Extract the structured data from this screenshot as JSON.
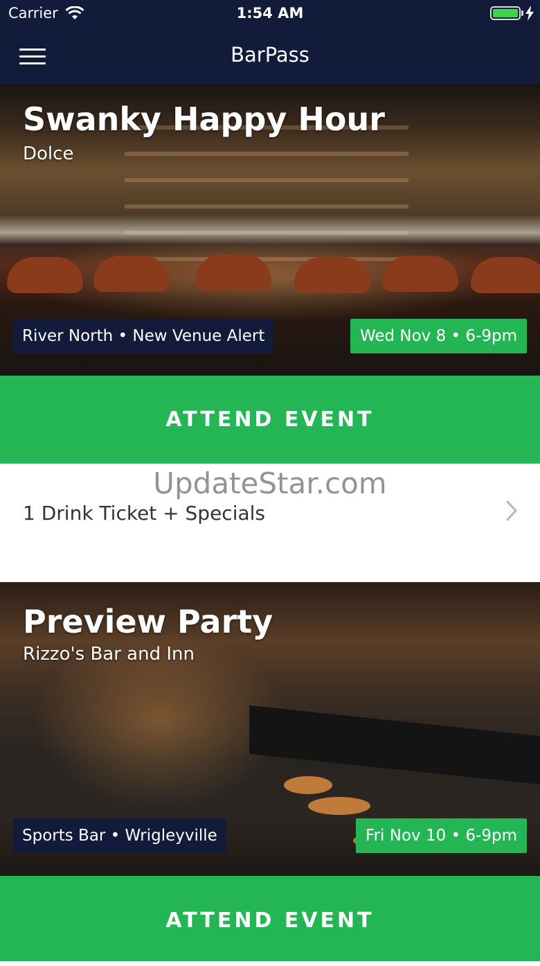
{
  "status_bar": {
    "carrier": "Carrier",
    "time": "1:54 AM",
    "battery_color": "#3bd64c"
  },
  "navbar": {
    "title": "BarPass",
    "menu_icon": "hamburger-menu-icon",
    "background": "#121c3a"
  },
  "events": [
    {
      "title": "Swanky Happy Hour",
      "venue": "Dolce",
      "tag_left": "River North • New Venue Alert",
      "tag_right": "Wed Nov 8 • 6-9pm",
      "attend_label": "ATTEND EVENT"
    },
    {
      "title": "Preview Party",
      "venue": "Rizzo's Bar and Inn",
      "tag_left": "Sports Bar • Wrigleyville",
      "tag_right": "Fri Nov 10 • 6-9pm",
      "attend_label": "ATTEND EVENT"
    }
  ],
  "offer": {
    "text": "1 Drink Ticket + Specials",
    "icon": "chevron-right-icon"
  },
  "watermark": "UpdateStar.com",
  "colors": {
    "accent": "#24b554",
    "navy": "#121c3a"
  }
}
